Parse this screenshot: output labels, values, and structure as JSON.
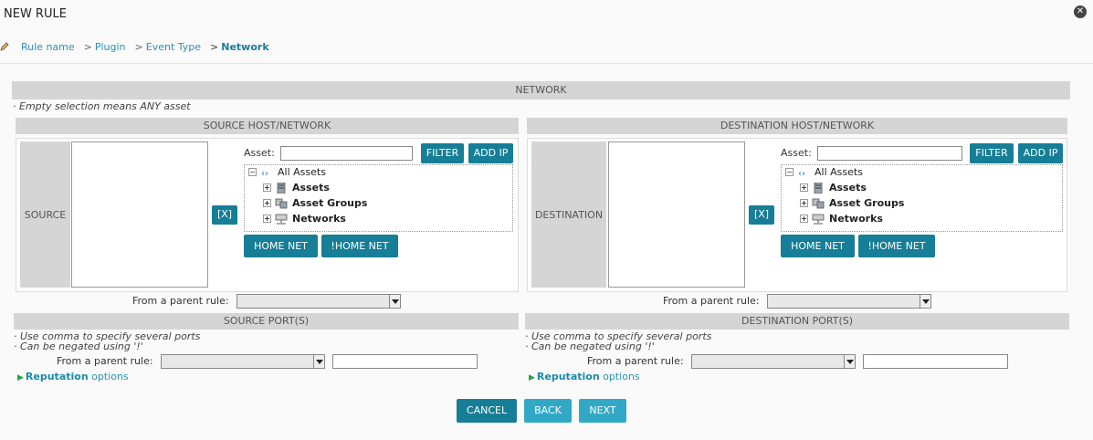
{
  "header": {
    "title": "NEW RULE"
  },
  "breadcrumb": {
    "items": [
      {
        "sep": "",
        "label": "Rule name"
      },
      {
        "sep": ">",
        "label": "Plugin"
      },
      {
        "sep": ">",
        "label": "Event Type"
      },
      {
        "sep": ">",
        "label": "Network"
      }
    ]
  },
  "network": {
    "heading": "NETWORK",
    "note": "· Empty selection means ANY asset"
  },
  "source": {
    "heading": "SOURCE HOST/NETWORK",
    "side_label": "SOURCE",
    "remove_label": "[X]",
    "asset_label": "Asset:",
    "asset_value": "",
    "filter_label": "FILTER",
    "add_ip_label": "ADD IP",
    "tree": {
      "root": "All Assets",
      "children": [
        "Assets",
        "Asset Groups",
        "Networks"
      ]
    },
    "home_net_label": "HOME NET",
    "not_home_net_label": "!HOME NET",
    "parent_rule_label": "From a parent rule:",
    "parent_rule_value": ""
  },
  "destination": {
    "heading": "DESTINATION HOST/NETWORK",
    "side_label": "DESTINATION",
    "remove_label": "[X]",
    "asset_label": "Asset:",
    "asset_value": "",
    "filter_label": "FILTER",
    "add_ip_label": "ADD IP",
    "tree": {
      "root": "All Assets",
      "children": [
        "Assets",
        "Asset Groups",
        "Networks"
      ]
    },
    "home_net_label": "HOME NET",
    "not_home_net_label": "!HOME NET",
    "parent_rule_label": "From a parent rule:",
    "parent_rule_value": ""
  },
  "source_port": {
    "heading": "SOURCE PORT(S)",
    "note1": "· Use comma to specify several ports",
    "note2": "· Can be negated using '!'",
    "parent_rule_label": "From a parent rule:",
    "parent_rule_value": "",
    "port_value": "",
    "reputation_bold": "Reputation",
    "reputation_rest": " options"
  },
  "destination_port": {
    "heading": "DESTINATION PORT(S)",
    "note1": "· Use comma to specify several ports",
    "note2": "· Can be negated using '!'",
    "parent_rule_label": "From a parent rule:",
    "parent_rule_value": "",
    "port_value": "",
    "reputation_bold": "Reputation",
    "reputation_rest": " options"
  },
  "footer": {
    "cancel_label": "CANCEL",
    "back_label": "BACK",
    "next_label": "NEXT"
  },
  "colors": {
    "primary_button": "#167e96",
    "secondary_button": "#31a9c6",
    "link": "#2a91b4"
  },
  "icons": {
    "close": "close-icon",
    "pencil": "pencil-icon",
    "expand": "plus-expander-icon",
    "collapse": "minus-expander-icon"
  }
}
